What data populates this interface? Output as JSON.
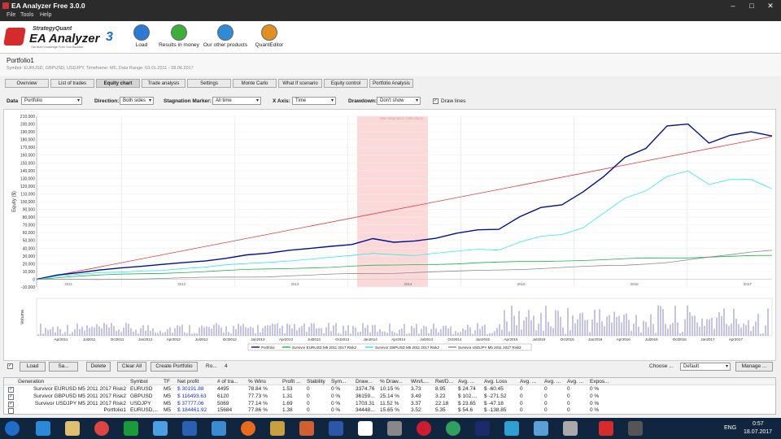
{
  "window": {
    "title": "EA Analyzer Free 3.0.0",
    "controls": [
      "–",
      "□",
      "✕"
    ]
  },
  "menu": [
    "File",
    "Tools",
    "Help"
  ],
  "toolbar": {
    "logo_brand": "StrategyQuant",
    "logo_name": "EA Analyzer",
    "logo_version": "3",
    "logo_tag": "Get More Knowledge From Your Backtest",
    "buttons": [
      "Load",
      "Results in money",
      "Our other products",
      "QuantEditor"
    ]
  },
  "portfolio": {
    "title": "Portfolio1",
    "subtitle": "Symbol: EURUSD, GBPUSD, USDJPY, Timeframe: M5, Data Range: 03.01.2011 - 28.06.2017"
  },
  "tabs": [
    "Overview",
    "List of trades",
    "Equity chart",
    "Trade analysis",
    "Settings",
    "Monte Carlo",
    "What If scenario",
    "Equity control",
    "Portfolio Analysis"
  ],
  "controls": {
    "data_label": "Data",
    "data_value": "Portfolio",
    "direction_label": "Direction:",
    "direction_value": "Both sides",
    "stagnation_label": "Stagnation Marker:",
    "stagnation_value": "All time",
    "xaxis_label": "X Axis:",
    "xaxis_value": "Time",
    "drawdown_label": "Drawdown:",
    "drawdown_value": "Don't show",
    "drawlines_label": "Draw lines",
    "drawlines_checked": true
  },
  "chart_data": {
    "type": "line",
    "ylabel": "Equity ($)",
    "volume_label": "Volume",
    "stagnation_text": "Max stagnation (396 days)",
    "ylim": [
      -10000,
      210000
    ],
    "y_ticks": [
      210000,
      200000,
      190000,
      180000,
      170000,
      160000,
      150000,
      140000,
      130000,
      120000,
      110000,
      100000,
      90000,
      80000,
      70000,
      60000,
      50000,
      40000,
      30000,
      20000,
      10000,
      0,
      -10000
    ],
    "x_month_ticks": [
      "Apr2011",
      "Jul2011",
      "Oct2011",
      "Jan2012",
      "Apr2012",
      "Jul2012",
      "Oct2012",
      "Jan2013",
      "Apr2013",
      "Jul2013",
      "Oct2013",
      "Jan2014",
      "Apr2014",
      "Jul2014",
      "Oct2014",
      "Jan2015",
      "Apr2015",
      "Jul2015",
      "Oct2015",
      "Jan2016",
      "Apr2016",
      "Jul2016",
      "Oct2016",
      "Jan2017",
      "Apr2017"
    ],
    "x_year_ticks": [
      "2011",
      "2012",
      "2013",
      "2014",
      "2015",
      "2016",
      "2017"
    ],
    "x_index": [
      0,
      3,
      6,
      9,
      12,
      15,
      18,
      21,
      24,
      27,
      30,
      33,
      36,
      39,
      42,
      45,
      48,
      51,
      54,
      57,
      60,
      63,
      66,
      69,
      72,
      75,
      78
    ],
    "series": [
      {
        "name": "Portfolio",
        "color": "#00108f",
        "values": [
          0,
          6000,
          9000,
          12000,
          14000,
          16000,
          19000,
          22000,
          24000,
          27000,
          31000,
          33000,
          37000,
          40000,
          43000,
          45000,
          52000,
          47000,
          49000,
          53000,
          60000,
          64000,
          64000,
          80000,
          92000,
          96000,
          113000,
          133000,
          157000,
          168000,
          197000,
          200000,
          176000,
          186000,
          190000,
          184000
        ]
      },
      {
        "name": "Survivor EURUSD M5 2011 2017 Risk2",
        "color": "#22b14c",
        "values": [
          0,
          2500,
          4000,
          5000,
          6000,
          7000,
          8000,
          9000,
          10000,
          11000,
          12000,
          13000,
          14000,
          15000,
          15500,
          16500,
          17500,
          18000,
          19000,
          19500,
          20000,
          21000,
          21500,
          22500,
          23000,
          24000,
          24500,
          25000,
          26000,
          27000,
          27500,
          28000,
          29000,
          29500,
          30000,
          30200
        ]
      },
      {
        "name": "Survivor GBPUSD M5 2011 2017 Risk2",
        "color": "#33e8e8",
        "values": [
          0,
          4000,
          6000,
          8000,
          9000,
          11000,
          12000,
          14000,
          15000,
          18000,
          20000,
          22000,
          24000,
          26000,
          28000,
          30000,
          33000,
          32000,
          31000,
          34000,
          36000,
          38000,
          37000,
          48000,
          56000,
          58000,
          66000,
          85000,
          104000,
          114000,
          133000,
          140000,
          122000,
          128000,
          128000,
          116500
        ]
      },
      {
        "name": "Survivor USDJPY M5 2011 2017 Risk2",
        "color": "#8a8a8a",
        "values": [
          0,
          -500,
          -700,
          -500,
          300,
          800,
          1200,
          1500,
          2000,
          2500,
          3000,
          3500,
          4500,
          5000,
          6000,
          7000,
          7500,
          8000,
          9000,
          9500,
          10000,
          11000,
          12000,
          13000,
          14000,
          15000,
          16000,
          17000,
          18000,
          20000,
          22000,
          25000,
          28000,
          31000,
          35000,
          37800
        ]
      }
    ],
    "stagnation_range_index": [
      34,
      41.5
    ],
    "trend_line": {
      "name": "",
      "color": "#e03a3a",
      "from": [
        0,
        0
      ],
      "to": [
        100,
        184000
      ]
    }
  },
  "bottom_bar": {
    "load": "Load",
    "save": "Sa...",
    "delete": "Delete",
    "clear_all": "Clear All",
    "create_portfolio": "Create Portfolio",
    "rows_label": "Ro...",
    "rows_value": "4",
    "choose_label": "Choose ...",
    "choose_value": "Default",
    "manage": "Manage ..."
  },
  "table": {
    "headers": [
      "Generation",
      "Symbol",
      "TF",
      "Net profit",
      "# of tra...",
      "% Wins",
      "Profit ...",
      "Stability",
      "Sym...",
      "Draw...",
      "% Draw...",
      "Win/L...",
      "Ret/D...",
      "Avg. ...",
      "Avg. Loss",
      "Avg. ...",
      "Avg. ...",
      "Avg. ...",
      "Expos..."
    ],
    "rows": [
      {
        "checked": true,
        "cells": [
          "Survivor EURUSD M5 2011 2017 Risk2",
          "EURUSD",
          "M5",
          "$ 30191.88",
          "4495",
          "78.84 %",
          "1.53",
          "0",
          "0 %",
          "3374.76",
          "10.15 %",
          "3.73",
          "8.95",
          "$ 24.74",
          "$ -60.45",
          "0",
          "0",
          "0",
          "0 %"
        ]
      },
      {
        "checked": true,
        "cells": [
          "Survivor GBPUSD M5 2011 2017 Risk2",
          "GBPUSD",
          "M5",
          "$ 116493.63",
          "6120",
          "77.73 %",
          "1.31",
          "0",
          "0 %",
          "36159...",
          "25.14 %",
          "3.49",
          "3.22",
          "$ 102....",
          "$ -271.52",
          "0",
          "0",
          "0",
          "0 %"
        ]
      },
      {
        "checked": true,
        "cells": [
          "Survivor USDJPY M5 2011 2017 Risk2",
          "USDJPY",
          "M5",
          "$ 37777.06",
          "5069",
          "77.14 %",
          "1.69",
          "0",
          "0 %",
          "1703.31",
          "11.52 %",
          "3.37",
          "22.18",
          "$ 23.65",
          "$ -47.18",
          "0",
          "0",
          "0",
          "0 %"
        ]
      },
      {
        "checked": false,
        "cells": [
          "Portfolio1",
          "EURUSD,...",
          "M5",
          "$ 184461.92",
          "15684",
          "77.86 %",
          "1.38",
          "0",
          "0 %",
          "34448...",
          "15.65 %",
          "3.52",
          "5.35",
          "$ 54.6",
          "$ -138.85",
          "0",
          "0",
          "0",
          "0 %"
        ]
      }
    ]
  },
  "taskbar": {
    "lang": "ENG",
    "time": "0:57",
    "date": "18.07.2017"
  }
}
